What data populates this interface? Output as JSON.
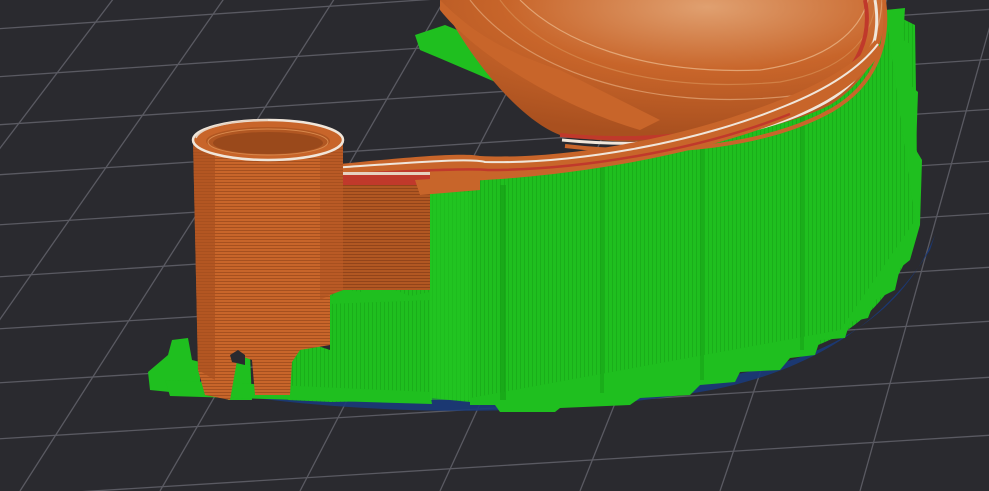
{
  "viewport": {
    "kind": "slicer-gcode-preview",
    "background_color": "#2a2a2f",
    "grid_color": "#5a5a62",
    "bed_visible": true
  },
  "model": {
    "perimeter_color": "#c8652a",
    "perimeter_dark_color": "#a9501f",
    "top_edge_color": "#e6d2c0",
    "overhang_color": "#c0392b",
    "support_color": "#1fbf1f",
    "support_dark_color": "#17a317",
    "brim_color": "#1a3a7a"
  }
}
